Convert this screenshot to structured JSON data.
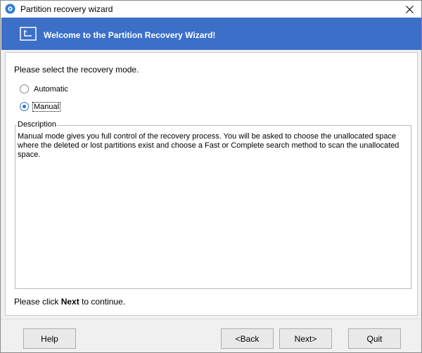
{
  "window": {
    "title": "Partition recovery wizard",
    "close_icon": "close-icon"
  },
  "banner": {
    "title": "Welcome to the Partition Recovery Wizard!",
    "icon": "wizard-icon",
    "color": "#3b6fc8"
  },
  "content": {
    "prompt": "Please select the recovery mode.",
    "modes": [
      {
        "label": "Automatic",
        "checked": false
      },
      {
        "label": "Manual",
        "checked": true
      }
    ],
    "description_legend": "Description",
    "description_text": "Manual mode gives you full control of the recovery process. You will be asked to choose the unallocated space where the deleted or lost partitions exist and choose a Fast or Complete search method to scan the unallocated space.",
    "continue_prefix": "Please click",
    "continue_bold": "Next",
    "continue_suffix": "to continue."
  },
  "buttons": {
    "help": "Help",
    "back": "<Back",
    "next": "Next>",
    "quit": "Quit"
  }
}
